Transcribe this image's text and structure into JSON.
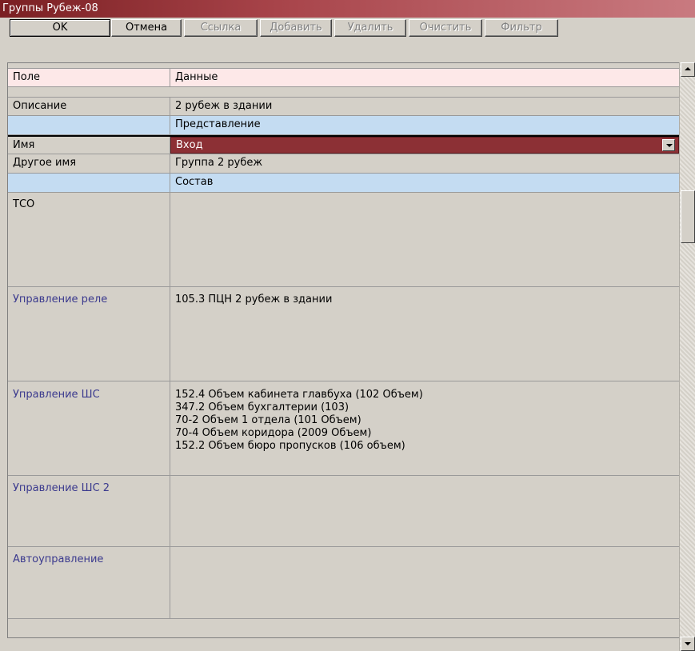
{
  "window": {
    "title": "Группы Рубеж-08"
  },
  "toolbar": {
    "ok": "OK",
    "cancel": "Отмена",
    "link": "Ссылка",
    "add": "Добавить",
    "delete": "Удалить",
    "clear": "Очистить",
    "filter": "Фильтр"
  },
  "grid": {
    "header": {
      "field": "Поле",
      "data": "Данные"
    },
    "description": {
      "label": "Описание",
      "value": "2 рубеж в здании"
    },
    "section_view": "Представление",
    "name": {
      "label": "Имя",
      "value": "Вход"
    },
    "other_name": {
      "label": "Другое имя",
      "value": "Группа 2 рубеж"
    },
    "section_composition": "Состав",
    "tco": {
      "label": "ТСО",
      "value": ""
    },
    "relay_control": {
      "label": "Управление реле",
      "value": "105.3 ПЦН 2 рубеж в здании"
    },
    "zone_control": {
      "label": "Управление ШС",
      "lines": [
        "152.4 Объем кабинета главбуха (102 Объем)",
        "347.2 Объем бухгалтерии (103)",
        "70-2 Объем 1 отдела (101 Объем)",
        "70-4 Объем коридора (2009 Объем)",
        "152.2 Объем бюро пропусков (106 объем)"
      ]
    },
    "zone_control_2": {
      "label": "Управление ШС 2",
      "value": ""
    },
    "auto_control": {
      "label": "Автоуправление",
      "value": ""
    }
  },
  "colors": {
    "title_bar": "#7a1f22",
    "header_row": "#fde8e8",
    "section_row": "#c4dcf2",
    "selected_row": "#8c3035",
    "link_label": "#3b3a8e"
  }
}
